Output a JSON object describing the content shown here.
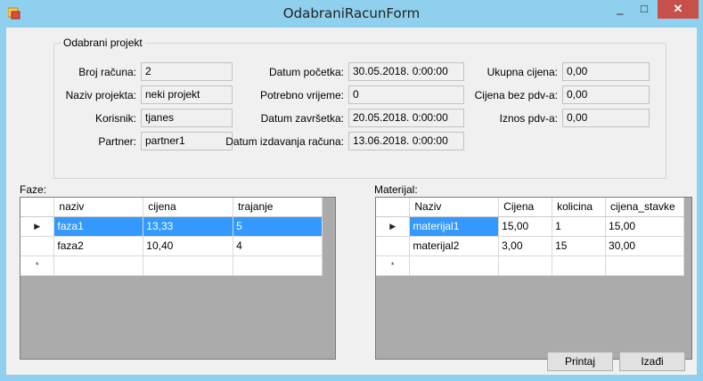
{
  "window": {
    "title": "OdabraniRacunForm",
    "min_glyph": "_",
    "max_glyph": "□",
    "close_glyph": "✕",
    "colors": {
      "chrome": "#8fd0ee",
      "close": "#c7504a",
      "selection": "#3399ff"
    }
  },
  "group": {
    "legend": "Odabrani projekt",
    "broj_racuna": {
      "label": "Broj računa:",
      "value": "2"
    },
    "naziv_projekta": {
      "label": "Naziv projekta:",
      "value": "neki projekt"
    },
    "korisnik": {
      "label": "Korisnik:",
      "value": "tjanes"
    },
    "partner": {
      "label": "Partner:",
      "value": "partner1"
    },
    "datum_pocetka": {
      "label": "Datum početka:",
      "value": "30.05.2018. 0:00:00"
    },
    "potrebno_vrijeme": {
      "label": "Potrebno vrijeme:",
      "value": "0"
    },
    "datum_zavrsetka": {
      "label": "Datum završetka:",
      "value": "20.05.2018. 0:00:00"
    },
    "datum_izdavanja": {
      "label": "Datum izdavanja računa:",
      "value": "13.06.2018. 0:00:00"
    },
    "ukupna_cijena": {
      "label": "Ukupna cijena:",
      "value": "0,00"
    },
    "cijena_bez_pdv": {
      "label": "Cijena bez pdv-a:",
      "value": "0,00"
    },
    "iznos_pdv": {
      "label": "Iznos pdv-a:",
      "value": "0,00"
    }
  },
  "faze": {
    "label": "Faze:",
    "columns": [
      "naziv",
      "cijena",
      "trajanje"
    ],
    "rows": [
      [
        "faza1",
        "13,33",
        "5"
      ],
      [
        "faza2",
        "10,40",
        "4"
      ]
    ],
    "current_row_glyph": "▶",
    "new_row_glyph": "*"
  },
  "materijal": {
    "label": "Materijal:",
    "columns": [
      "Naziv",
      "Cijena",
      "kolicina",
      "cijena_stavke"
    ],
    "rows": [
      [
        "materijal1",
        "15,00",
        "1",
        "15,00"
      ],
      [
        "materijal2",
        "3,00",
        "15",
        "30,00"
      ]
    ],
    "current_row_glyph": "▶",
    "new_row_glyph": "*"
  },
  "buttons": {
    "printaj": "Printaj",
    "izadji": "Izađi"
  }
}
